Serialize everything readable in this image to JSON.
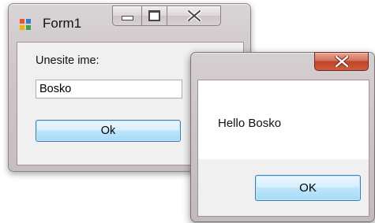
{
  "form1": {
    "title": "Form1",
    "label": "Unesite ime:",
    "name_value": "Bosko",
    "ok_label": "Ok"
  },
  "message_box": {
    "text": "Hello Bosko",
    "ok_label": "OK"
  }
}
